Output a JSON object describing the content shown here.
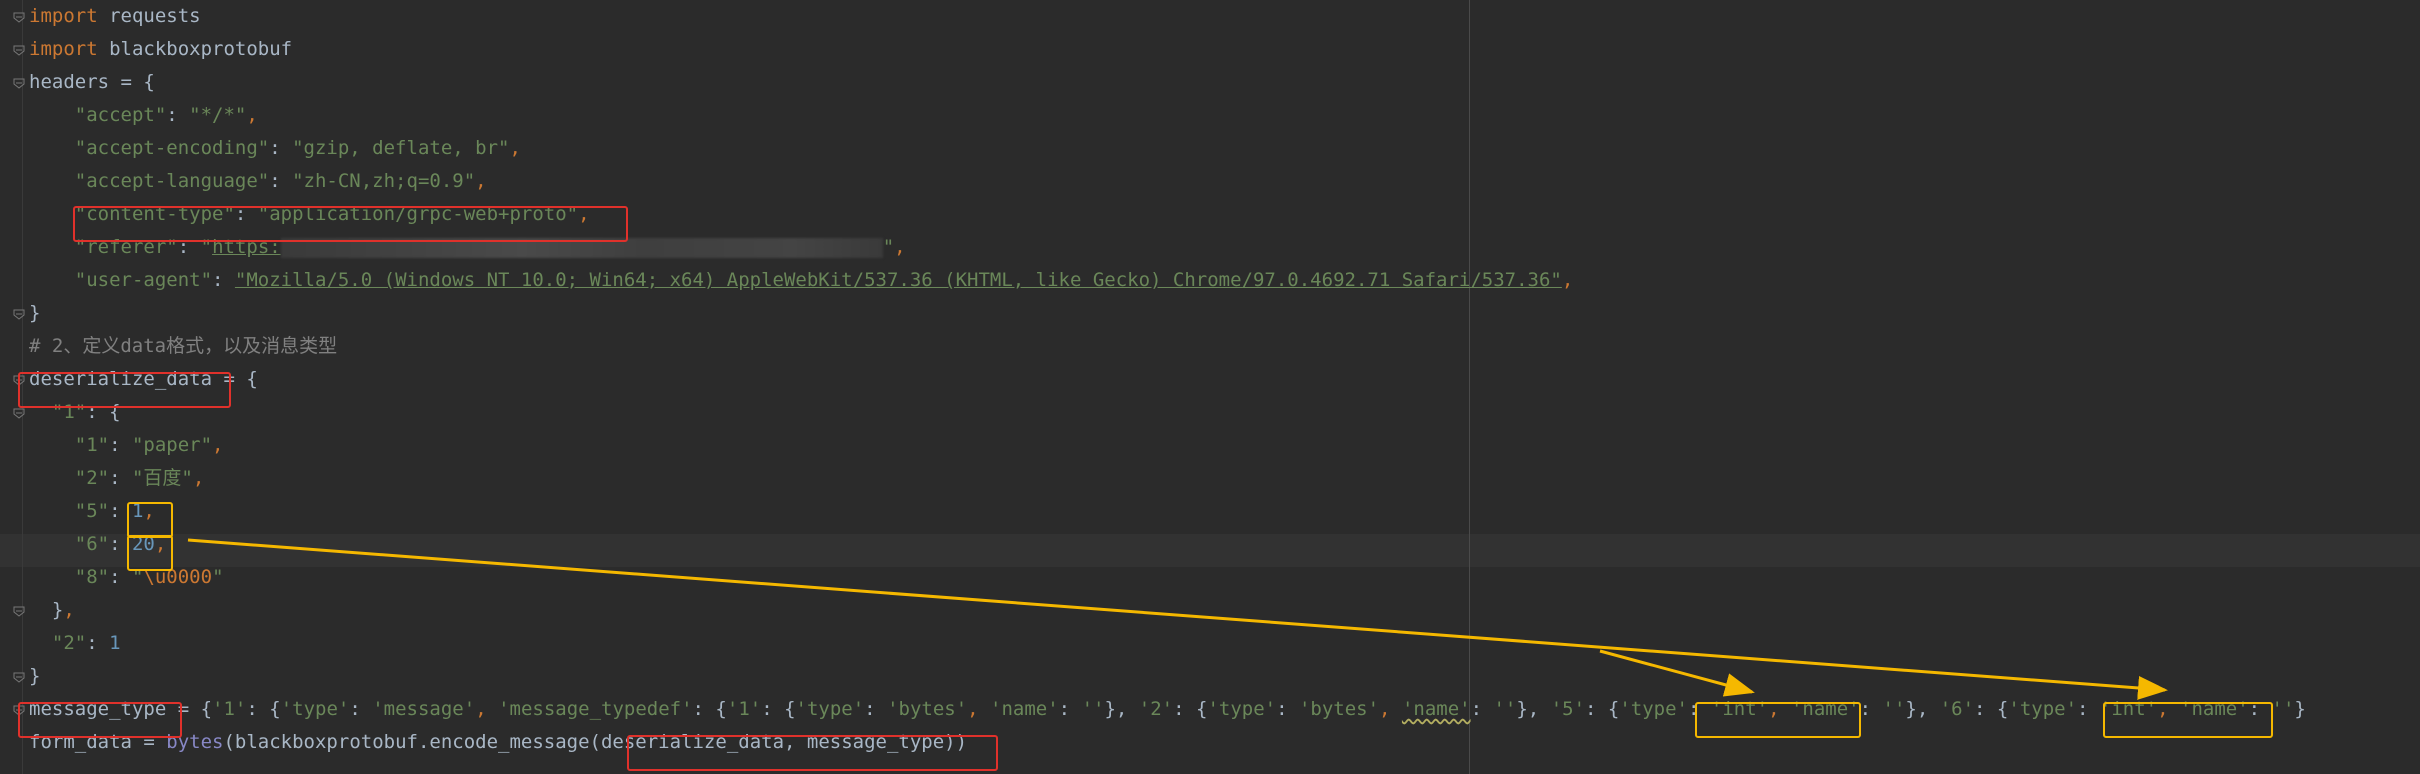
{
  "editor": {
    "lines": [
      {
        "id": "l1",
        "parts": [
          {
            "t": "import",
            "c": "kw"
          },
          {
            "t": " requests",
            "c": "plain"
          }
        ]
      },
      {
        "id": "l2",
        "parts": [
          {
            "t": "import",
            "c": "kw"
          },
          {
            "t": " blackboxprotobuf",
            "c": "plain"
          }
        ]
      },
      {
        "id": "l3",
        "parts": [
          {
            "t": "headers = {",
            "c": "plain"
          }
        ]
      },
      {
        "id": "l4",
        "parts": [
          {
            "t": "    \"accept\"",
            "c": "str"
          },
          {
            "t": ": ",
            "c": "plain"
          },
          {
            "t": "\"*/*\"",
            "c": "str"
          },
          {
            "t": ",",
            "c": "kw"
          }
        ]
      },
      {
        "id": "l5",
        "parts": [
          {
            "t": "    \"accept-encoding\"",
            "c": "str"
          },
          {
            "t": ": ",
            "c": "plain"
          },
          {
            "t": "\"gzip, deflate, br\"",
            "c": "str"
          },
          {
            "t": ",",
            "c": "kw"
          }
        ]
      },
      {
        "id": "l6",
        "parts": [
          {
            "t": "    \"accept-language\"",
            "c": "str"
          },
          {
            "t": ": ",
            "c": "plain"
          },
          {
            "t": "\"zh-CN,zh;q=0.9\"",
            "c": "str"
          },
          {
            "t": ",",
            "c": "kw"
          }
        ]
      },
      {
        "id": "l7",
        "parts": [
          {
            "t": "    \"content-type\"",
            "c": "str"
          },
          {
            "t": ": ",
            "c": "plain"
          },
          {
            "t": "\"application/grpc-web+proto\"",
            "c": "str"
          },
          {
            "t": ",",
            "c": "kw"
          }
        ]
      },
      {
        "id": "l8",
        "parts": [
          {
            "t": "    \"referer\"",
            "c": "str"
          },
          {
            "t": ": ",
            "c": "plain"
          },
          {
            "t": "\"",
            "c": "str"
          },
          {
            "t": "https:",
            "c": "url"
          },
          {
            "t": "",
            "c": "blur"
          },
          {
            "t": "\"",
            "c": "str"
          },
          {
            "t": ",",
            "c": "kw"
          }
        ]
      },
      {
        "id": "l9",
        "parts": [
          {
            "t": "    \"user-agent\"",
            "c": "str"
          },
          {
            "t": ": ",
            "c": "plain"
          },
          {
            "t": "\"Mozilla/5.0 (Windows NT 10.0; Win64; x64) AppleWebKit/537.36 (KHTML, like Gecko) Chrome/97.0.4692.71 Safari/537.36\"",
            "c": "url"
          },
          {
            "t": ",",
            "c": "kw"
          }
        ]
      },
      {
        "id": "l10",
        "parts": [
          {
            "t": "}",
            "c": "plain"
          }
        ]
      },
      {
        "id": "l11",
        "parts": [
          {
            "t": "# 2、定义data格式，以及消息类型",
            "c": "cmt"
          }
        ]
      },
      {
        "id": "l12",
        "parts": [
          {
            "t": "deserialize_data",
            "c": "plain"
          },
          {
            "t": " = {",
            "c": "plain"
          }
        ]
      },
      {
        "id": "l13",
        "parts": [
          {
            "t": "  \"1\"",
            "c": "str"
          },
          {
            "t": ": {",
            "c": "plain"
          }
        ]
      },
      {
        "id": "l14",
        "parts": [
          {
            "t": "    \"1\"",
            "c": "str"
          },
          {
            "t": ": ",
            "c": "plain"
          },
          {
            "t": "\"paper\"",
            "c": "str"
          },
          {
            "t": ",",
            "c": "kw"
          }
        ]
      },
      {
        "id": "l15",
        "parts": [
          {
            "t": "    \"2\"",
            "c": "str"
          },
          {
            "t": ": ",
            "c": "plain"
          },
          {
            "t": "\"百度\"",
            "c": "str"
          },
          {
            "t": ",",
            "c": "kw"
          }
        ]
      },
      {
        "id": "l16",
        "parts": [
          {
            "t": "    \"5\"",
            "c": "str"
          },
          {
            "t": ": ",
            "c": "plain"
          },
          {
            "t": "1",
            "c": "num"
          },
          {
            "t": ",",
            "c": "kw"
          }
        ]
      },
      {
        "id": "l17",
        "parts": [
          {
            "t": "    \"6\"",
            "c": "str"
          },
          {
            "t": ": ",
            "c": "plain"
          },
          {
            "t": "20",
            "c": "num"
          },
          {
            "t": ",",
            "c": "kw"
          }
        ]
      },
      {
        "id": "l18",
        "parts": [
          {
            "t": "    \"8\"",
            "c": "str"
          },
          {
            "t": ": ",
            "c": "plain"
          },
          {
            "t": "\"",
            "c": "str"
          },
          {
            "t": "\\u0000",
            "c": "esc"
          },
          {
            "t": "\"",
            "c": "str"
          }
        ]
      },
      {
        "id": "l19",
        "parts": [
          {
            "t": "  }",
            "c": "plain"
          },
          {
            "t": ",",
            "c": "kw"
          }
        ]
      },
      {
        "id": "l20",
        "parts": [
          {
            "t": "  \"2\"",
            "c": "str"
          },
          {
            "t": ": ",
            "c": "plain"
          },
          {
            "t": "1",
            "c": "num"
          }
        ]
      },
      {
        "id": "l21",
        "parts": [
          {
            "t": "}",
            "c": "plain"
          }
        ]
      },
      {
        "id": "l22",
        "parts": [
          {
            "t": "message_type",
            "c": "plain"
          },
          {
            "t": " = {",
            "c": "plain"
          },
          {
            "t": "'1'",
            "c": "str"
          },
          {
            "t": ": {",
            "c": "plain"
          },
          {
            "t": "'type'",
            "c": "str"
          },
          {
            "t": ": ",
            "c": "plain"
          },
          {
            "t": "'message'",
            "c": "str"
          },
          {
            "t": ", ",
            "c": "kw"
          },
          {
            "t": "'message_typedef'",
            "c": "str"
          },
          {
            "t": ": {",
            "c": "plain"
          },
          {
            "t": "'1'",
            "c": "str"
          },
          {
            "t": ": {",
            "c": "plain"
          },
          {
            "t": "'type'",
            "c": "str"
          },
          {
            "t": ": ",
            "c": "plain"
          },
          {
            "t": "'bytes'",
            "c": "str"
          },
          {
            "t": ", ",
            "c": "kw"
          },
          {
            "t": "'name'",
            "c": "str"
          },
          {
            "t": ": ",
            "c": "plain"
          },
          {
            "t": "''",
            "c": "str"
          },
          {
            "t": "}, ",
            "c": "plain"
          },
          {
            "t": "'2'",
            "c": "str"
          },
          {
            "t": ": {",
            "c": "plain"
          },
          {
            "t": "'type'",
            "c": "str"
          },
          {
            "t": ": ",
            "c": "plain"
          },
          {
            "t": "'bytes'",
            "c": "str"
          },
          {
            "t": ", ",
            "c": "kw"
          },
          {
            "t": "'name'",
            "c": "str squig"
          },
          {
            "t": ": ",
            "c": "plain"
          },
          {
            "t": "''",
            "c": "str"
          },
          {
            "t": "}, ",
            "c": "plain"
          },
          {
            "t": "'5'",
            "c": "str"
          },
          {
            "t": ": {",
            "c": "plain"
          },
          {
            "t": "'type'",
            "c": "str"
          },
          {
            "t": ": ",
            "c": "plain"
          },
          {
            "t": "'int'",
            "c": "str"
          },
          {
            "t": ", ",
            "c": "kw"
          },
          {
            "t": "'name'",
            "c": "str"
          },
          {
            "t": ": ",
            "c": "plain"
          },
          {
            "t": "''",
            "c": "str"
          },
          {
            "t": "}, ",
            "c": "plain"
          },
          {
            "t": "'6'",
            "c": "str"
          },
          {
            "t": ": {",
            "c": "plain"
          },
          {
            "t": "'type'",
            "c": "str"
          },
          {
            "t": ": ",
            "c": "plain"
          },
          {
            "t": "'int'",
            "c": "str"
          },
          {
            "t": ", ",
            "c": "kw"
          },
          {
            "t": "'name'",
            "c": "str"
          },
          {
            "t": ": ",
            "c": "plain"
          },
          {
            "t": "''",
            "c": "str"
          },
          {
            "t": "}",
            "c": "plain"
          }
        ]
      },
      {
        "id": "l23",
        "parts": [
          {
            "t": "form_data = ",
            "c": "plain"
          },
          {
            "t": "bytes",
            "c": "bi"
          },
          {
            "t": "(blackboxprotobuf.encode_message(",
            "c": "plain"
          },
          {
            "t": "deserialize_data, message_type",
            "c": "plain"
          },
          {
            "t": "))",
            "c": "plain"
          }
        ]
      }
    ]
  },
  "colors": {
    "background": "#2b2b2b",
    "keyword": "#cc7832",
    "string": "#6a8759",
    "number": "#6897bb",
    "comment": "#808080",
    "builtin": "#8888c6",
    "annotation_red": "#e0312b",
    "annotation_yellow": "#f5b800"
  }
}
